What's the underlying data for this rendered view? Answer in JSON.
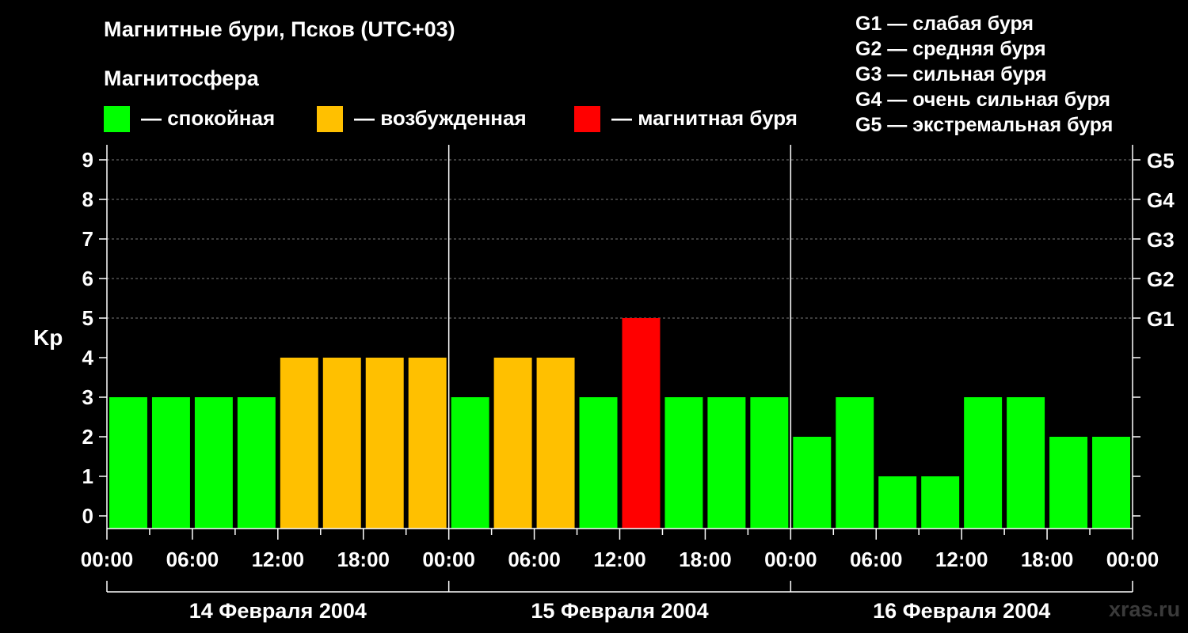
{
  "title": "Магнитные бури, Псков (UTC+03)",
  "subtitle": "Магнитосфера",
  "legend": [
    {
      "label": "— спокойная",
      "color": "#00ff00"
    },
    {
      "label": "— возбужденная",
      "color": "#ffc000"
    },
    {
      "label": "— магнитная буря",
      "color": "#ff0000"
    }
  ],
  "storm_levels": [
    "G1 — слабая буря",
    "G2 — средняя буря",
    "G3 — сильная буря",
    "G4 — очень сильная буря",
    "G5 — экстремальная буря"
  ],
  "watermark": "xras.ru",
  "chart_data": {
    "type": "bar",
    "title": "Магнитные бури, Псков (UTC+03)",
    "ylabel": "Kp",
    "xlabel": "",
    "ylim": [
      0,
      9
    ],
    "y_ticks": [
      "0",
      "1",
      "2",
      "3",
      "4",
      "5",
      "6",
      "7",
      "8",
      "9"
    ],
    "right_ticks": [
      {
        "y": 5,
        "label": "G1"
      },
      {
        "y": 6,
        "label": "G2"
      },
      {
        "y": 7,
        "label": "G3"
      },
      {
        "y": 8,
        "label": "G4"
      },
      {
        "y": 9,
        "label": "G5"
      }
    ],
    "x_tick_labels": [
      "00:00",
      "06:00",
      "12:00",
      "18:00",
      "00:00",
      "06:00",
      "12:00",
      "18:00",
      "00:00",
      "06:00",
      "12:00",
      "18:00",
      "00:00"
    ],
    "days": [
      "14 Февраля 2004",
      "15 Февраля 2004",
      "16 Февраля 2004"
    ],
    "values": [
      3,
      3,
      3,
      3,
      4,
      4,
      4,
      4,
      3,
      4,
      4,
      3,
      5,
      3,
      3,
      3,
      2,
      3,
      1,
      1,
      3,
      3,
      2,
      2
    ],
    "colors": [
      "#00ff00",
      "#00ff00",
      "#00ff00",
      "#00ff00",
      "#ffc000",
      "#ffc000",
      "#ffc000",
      "#ffc000",
      "#00ff00",
      "#ffc000",
      "#ffc000",
      "#00ff00",
      "#ff0000",
      "#00ff00",
      "#00ff00",
      "#00ff00",
      "#00ff00",
      "#00ff00",
      "#00ff00",
      "#00ff00",
      "#00ff00",
      "#00ff00",
      "#00ff00",
      "#00ff00"
    ],
    "interval_hours": 3,
    "grid": true
  }
}
